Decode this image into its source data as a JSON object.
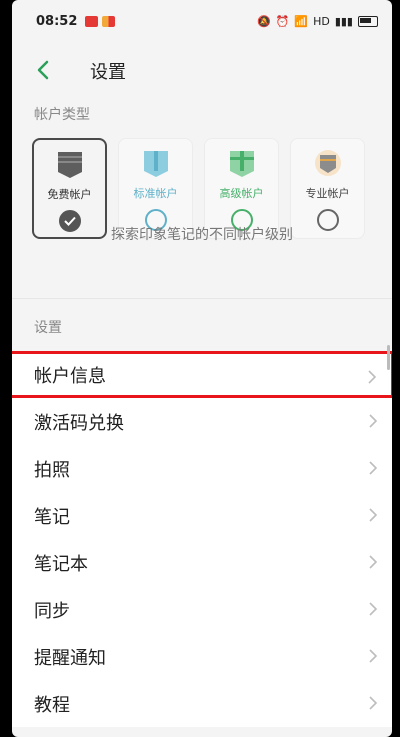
{
  "status_bar": {
    "time": "08:52",
    "network": "HD"
  },
  "header": {
    "title": "设置"
  },
  "account_types": {
    "label": "帐户类型",
    "tiers": [
      {
        "label": "免费帐户",
        "color": "#4a4a4a",
        "selected": true
      },
      {
        "label": "标准帐户",
        "color": "#5fb0c9",
        "selected": false
      },
      {
        "label": "高级帐户",
        "color": "#46b06a",
        "selected": false
      },
      {
        "label": "专业帐户",
        "color": "#4a4a4a",
        "selected": false
      }
    ],
    "explore_text": "探索印象笔记的不同帐户级别"
  },
  "settings": {
    "label": "设置",
    "items": [
      {
        "label": "帐户信息"
      },
      {
        "label": "激活码兑换"
      },
      {
        "label": "拍照"
      },
      {
        "label": "笔记"
      },
      {
        "label": "笔记本"
      },
      {
        "label": "同步"
      },
      {
        "label": "提醒通知"
      },
      {
        "label": "教程"
      }
    ]
  },
  "colors": {
    "accent": "#2aa05a",
    "highlight_border": "#e8151b"
  }
}
